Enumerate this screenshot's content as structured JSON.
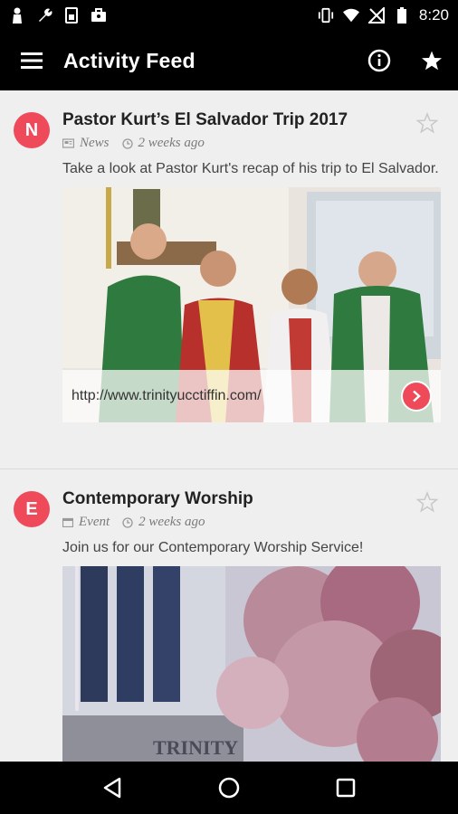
{
  "status_bar": {
    "time": "8:20"
  },
  "app_bar": {
    "title": "Activity Feed"
  },
  "feed": [
    {
      "avatar_letter": "N",
      "title": "Pastor Kurt’s El Salvador Trip 2017",
      "category": "News",
      "time_ago": "2 weeks ago",
      "description": "Take a look at Pastor Kurt's recap of his trip to El Salvador.",
      "link_url": "http://www.trinityucctiffin.com/"
    },
    {
      "avatar_letter": "E",
      "title": "Contemporary Worship",
      "category": "Event",
      "time_ago": "2 weeks ago",
      "description": "Join us for our Contemporary Worship Service!",
      "image_sign_text": "TRINITY"
    }
  ],
  "colors": {
    "accent": "#ee4a5a",
    "bar": "#000000",
    "background": "#efefef"
  }
}
